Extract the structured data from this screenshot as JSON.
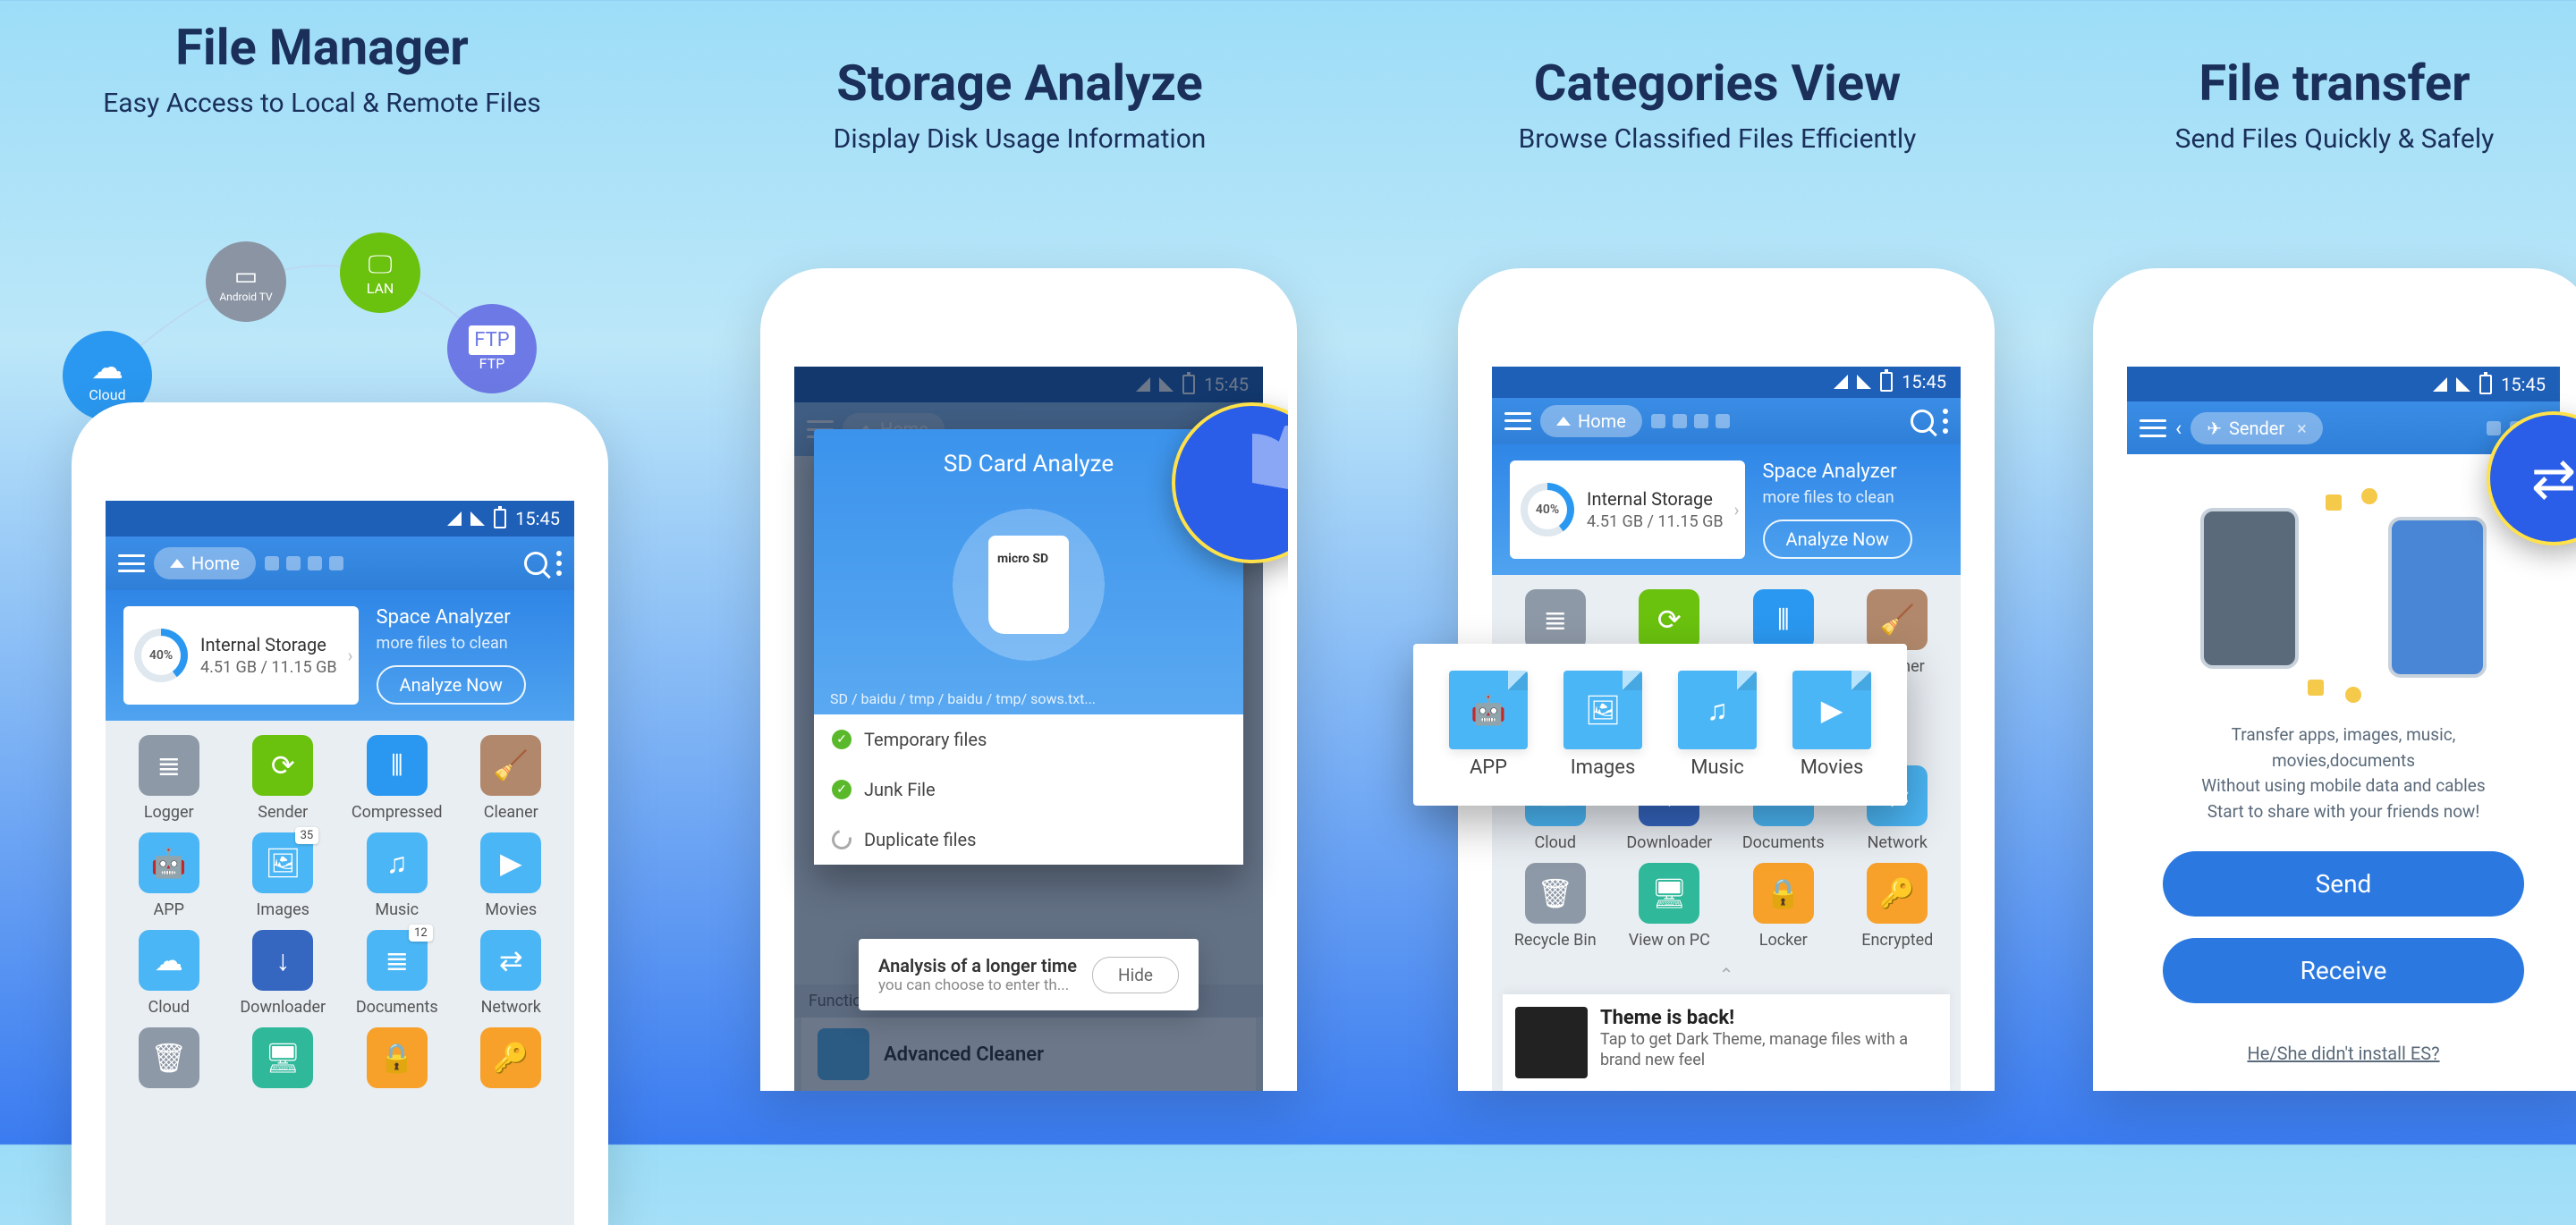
{
  "panels": [
    {
      "title": "File Manager",
      "subtitle": "Easy Access to Local & Remote Files"
    },
    {
      "title": "Storage Analyze",
      "subtitle": "Display Disk Usage Information"
    },
    {
      "title": "Categories View",
      "subtitle": "Browse Classified Files Efficiently"
    },
    {
      "title": "File transfer",
      "subtitle": "Send Files Quickly & Safely"
    }
  ],
  "orbit": {
    "cloud": "Cloud",
    "tv": "Android TV",
    "lan": "LAN",
    "ftp": "FTP"
  },
  "statusbar": {
    "time": "15:45"
  },
  "appbar": {
    "home": "Home",
    "sender": "Sender"
  },
  "storage": {
    "percent": "40%",
    "name": "Internal Storage",
    "size": "4.51 GB / 11.15 GB",
    "analyzer_title": "Space Analyzer",
    "analyzer_sub": "more files to clean",
    "analyze_btn": "Analyze Now"
  },
  "grid": {
    "logger": "Logger",
    "sender": "Sender",
    "compressed": "Compressed",
    "cleaner": "Cleaner",
    "app": "APP",
    "images": "Images",
    "music": "Music",
    "movies": "Movies",
    "cloud": "Cloud",
    "downloader": "Downloader",
    "documents": "Documents",
    "network": "Network",
    "recycle": "Recycle Bin",
    "viewpc": "View on PC",
    "locker": "Locker",
    "encrypted": "Encrypted",
    "images_badge": "35",
    "documents_badge": "12"
  },
  "sd": {
    "title": "SD Card Analyze",
    "path": "SD / baidu / tmp / baidu / tmp/ sows.txt...",
    "row1": "Temporary files",
    "row2": "Junk File",
    "row3": "Duplicate files",
    "note_title": "Analysis of a longer time",
    "note_sub": "you can choose to enter th...",
    "hide": "Hide",
    "function": "Function",
    "advanced": "Advanced Cleaner"
  },
  "theme": {
    "title": "Theme is back!",
    "sub": "Tap to get Dark Theme, manage files with a brand new feel"
  },
  "transfer": {
    "desc1": "Transfer apps, images, music, movies,documents",
    "desc2": "Without using mobile data and cables",
    "desc3": "Start to share with your friends now!",
    "send": "Send",
    "receive": "Receive",
    "link": "He/She didn't install ES?"
  }
}
